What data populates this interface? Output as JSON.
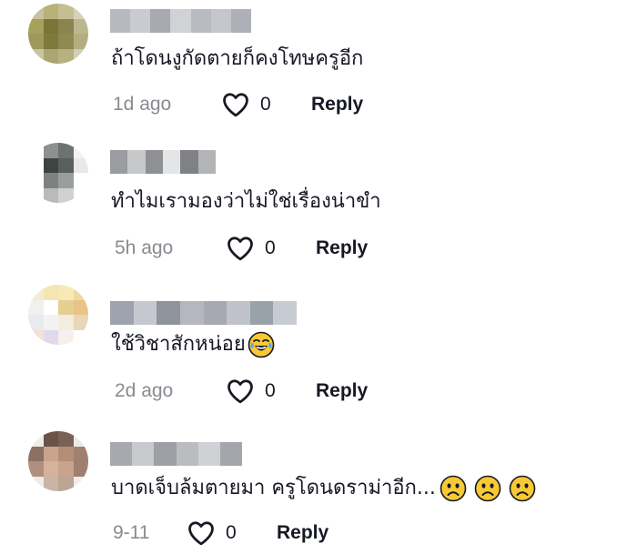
{
  "comments": [
    {
      "text": "ถ้าโดนงูกัดตายก็คงโทษครูอีก",
      "time": "1d ago",
      "likes": "0",
      "reply_label": "Reply",
      "avatar_colors": [
        "#c8c2a0",
        "#b8b27a",
        "#c4be92",
        "#d6d2b8",
        "#a6a15c",
        "#7a7438",
        "#8a8450",
        "#bcb78e",
        "#9e9958",
        "#7d7a3e",
        "#8f8a52",
        "#b3ae80",
        "#c9c4a4",
        "#aaa572",
        "#b6b183",
        "#d3cfb6"
      ],
      "username_colors": [
        "#b7b9c0",
        "#c9cbd0",
        "#a8aab2",
        "#d0d2d6",
        "#b9bbc2",
        "#c4c6cb",
        "#aeb0b7"
      ]
    },
    {
      "text": "ทำไมเรามองว่าไม่ใช่เรื่องน่าขำ",
      "time": "5h ago",
      "likes": "0",
      "reply_label": "Reply",
      "avatar_colors": [
        "#ffffff",
        "#8c908f",
        "#6e7371",
        "#f2f2f2",
        "#ffffff",
        "#3e4442",
        "#5a5f5d",
        "#e8e8e8",
        "#ffffff",
        "#7d817f",
        "#9a9e9c",
        "#ffffff",
        "#ffffff",
        "#b8bbba",
        "#d0d2d1",
        "#ffffff"
      ],
      "username_colors": [
        "#9a9c9f",
        "#c6c8ca",
        "#8e9093",
        "#e4e5e6",
        "#7f8184",
        "#b2b4b6"
      ]
    },
    {
      "text": "ใช้วิชาสักหน่อย",
      "time": "2d ago",
      "likes": "0",
      "reply_label": "Reply",
      "avatar_colors": [
        "#f4ecd0",
        "#f3e6b4",
        "#f6e9b6",
        "#f0d9a0",
        "#f0f0ee",
        "#ffffff",
        "#e4ce92",
        "#e8c487",
        "#e9eaf0",
        "#f2f2f0",
        "#f5ece0",
        "#e9d7b8",
        "#f3e2d4",
        "#e2d8ec",
        "#f6f0ec",
        "#ffffff"
      ],
      "username_colors": [
        "#9fa3ad",
        "#c5c8cf",
        "#8f939c",
        "#b4b7be",
        "#a6a9b1",
        "#bfc2c8",
        "#9aa2a9",
        "#c6ccd2"
      ]
    },
    {
      "text": "บาดเจ็บล้มตายมา ครูโดนดราม่าอีก...",
      "time": "9-11",
      "likes": "0",
      "reply_label": "Reply",
      "avatar_colors": [
        "#f1ece8",
        "#6a5449",
        "#7a6156",
        "#efe9e4",
        "#8b7063",
        "#caa48c",
        "#b48e78",
        "#a1806f",
        "#b08f80",
        "#d4b29c",
        "#c8a38d",
        "#9f8070",
        "#eeeae7",
        "#c9b4a6",
        "#bda594",
        "#f2eeeb"
      ],
      "username_colors": [
        "#a7a9ae",
        "#c7c9cc",
        "#9d9fa4",
        "#babcc0",
        "#d0d1d4",
        "#a4a6ab"
      ]
    }
  ],
  "icons": {
    "like": "heart-outline-icon",
    "laugh": "face-with-tears-of-joy-icon",
    "sad": "frowning-face-icon"
  },
  "colors": {
    "text": "#161823",
    "muted": "#8a8b91",
    "emoji_yellow": "#f7c934"
  }
}
